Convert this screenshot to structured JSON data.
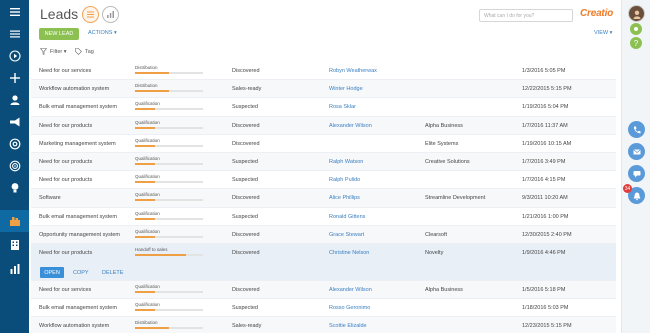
{
  "header": {
    "title": "Leads",
    "search_placeholder": "What can I do for you?",
    "logo": "Creatio"
  },
  "toolbar": {
    "new_lead": "NEW LEAD",
    "actions": "ACTIONS ▾",
    "view": "VIEW ▾",
    "filter": "Filter ▾",
    "tag": "Tag"
  },
  "row_actions": {
    "open": "OPEN",
    "copy": "COPY",
    "delete": "DELETE"
  },
  "colors": {
    "nav": "#0a4d7a",
    "accent_orange": "#ef7b2a",
    "new_lead_green": "#8cc152",
    "link_blue": "#3a7fc1",
    "progress_orange": "#f0a044"
  },
  "icons": {
    "left_nav": [
      "menu-icon",
      "play-icon",
      "plus-icon",
      "user-icon",
      "megaphone-icon",
      "at-icon",
      "target-icon",
      "lightbulb-icon",
      "leads-icon",
      "building-icon",
      "chart-icon"
    ],
    "right_bar": [
      "avatar",
      "gear-icon",
      "help-icon",
      "phone-icon",
      "mail-icon",
      "chat-icon",
      "bell-icon"
    ],
    "notification_count": "34"
  },
  "leads": [
    {
      "name": "Need for our services",
      "stage": "Distribution",
      "progress": 0.5,
      "need": "Discovered",
      "contact": "Robyn Weatherwax",
      "account": "",
      "date": "1/3/2016 5:05 PM"
    },
    {
      "name": "Workflow automation system",
      "stage": "Distribution",
      "progress": 0.5,
      "need": "Sales-ready",
      "contact": "Winter Hodge",
      "account": "",
      "date": "12/22/2015 5:15 PM"
    },
    {
      "name": "Bulk email management system",
      "stage": "Qualification",
      "progress": 0.3,
      "need": "Suspected",
      "contact": "Rosa Sklar",
      "account": "",
      "date": "1/19/2016 5:04 PM"
    },
    {
      "name": "Need for our products",
      "stage": "Qualification",
      "progress": 0.3,
      "need": "Discovered",
      "contact": "Alexander Wilson",
      "account": "Alpha Business",
      "date": "1/7/2016 11:37 AM"
    },
    {
      "name": "Marketing management system",
      "stage": "Qualification",
      "progress": 0.3,
      "need": "Discovered",
      "contact": "",
      "account": "Elite Systems",
      "date": "1/19/2016 10:15 AM"
    },
    {
      "name": "Need for our products",
      "stage": "Qualification",
      "progress": 0.3,
      "need": "Suspected",
      "contact": "Ralph Watson",
      "account": "Creative Solutions",
      "date": "1/7/2016 3:49 PM"
    },
    {
      "name": "Need for our products",
      "stage": "Qualification",
      "progress": 0.3,
      "need": "Suspected",
      "contact": "Ralph Pulido",
      "account": "",
      "date": "1/7/2016 4:15 PM"
    },
    {
      "name": "Software",
      "stage": "Qualification",
      "progress": 0.3,
      "need": "Discovered",
      "contact": "Alice Phillips",
      "account": "Streamline Development",
      "date": "9/3/2011 10:20 AM"
    },
    {
      "name": "Bulk email management system",
      "stage": "Qualification",
      "progress": 0.3,
      "need": "Suspected",
      "contact": "Ronald Gittens",
      "account": "",
      "date": "1/21/2016 1:00 PM"
    },
    {
      "name": "Opportunity management system",
      "stage": "Qualification",
      "progress": 0.3,
      "need": "Discovered",
      "contact": "Grace Stewart",
      "account": "Clearsoft",
      "date": "12/30/2015 2:40 PM"
    },
    {
      "name": "Need for our products",
      "stage": "Handoff to sales",
      "progress": 0.75,
      "need": "Discovered",
      "contact": "Christine Nelson",
      "account": "Novelty",
      "date": "1/9/2016 4:46 PM",
      "selected": true
    },
    {
      "name": "Need for our services",
      "stage": "Qualification",
      "progress": 0.3,
      "need": "Discovered",
      "contact": "Alexander Wilson",
      "account": "Alpha Business",
      "date": "1/5/2016 5:18 PM"
    },
    {
      "name": "Bulk email management system",
      "stage": "Qualification",
      "progress": 0.3,
      "need": "Suspected",
      "contact": "Rosso Geronimo",
      "account": "",
      "date": "1/18/2016 5:03 PM"
    },
    {
      "name": "Workflow automation system",
      "stage": "Distribution",
      "progress": 0.5,
      "need": "Sales-ready",
      "contact": "Scottie Elizalde",
      "account": "",
      "date": "12/23/2015 5:15 PM"
    }
  ]
}
